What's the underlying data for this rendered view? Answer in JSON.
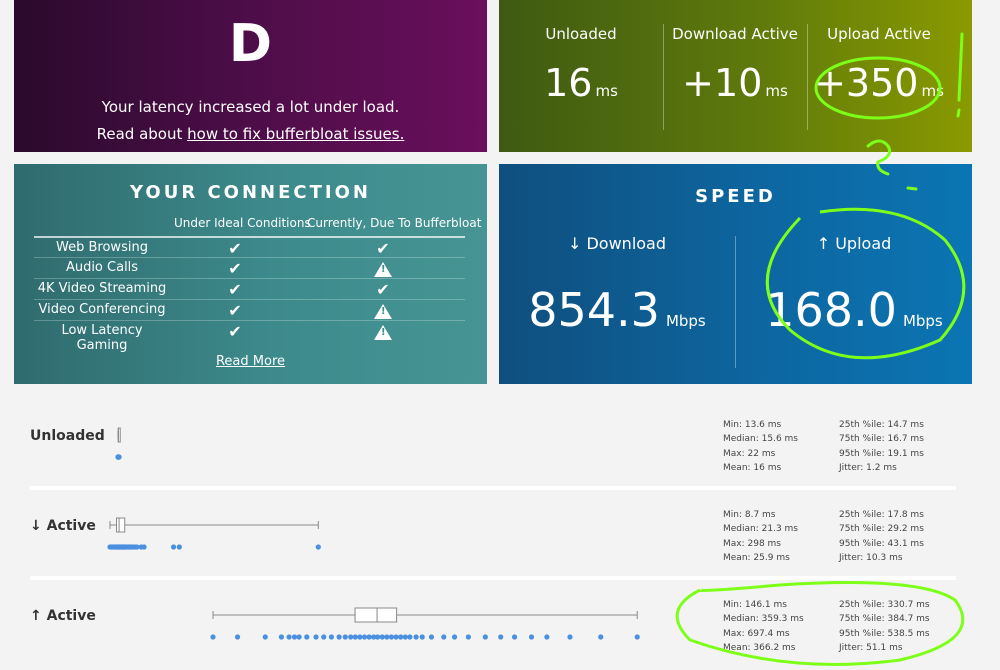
{
  "grade": {
    "letter": "D",
    "message": "Your latency increased a lot under load.",
    "read_about": "Read about ",
    "link_text": "how to fix bufferbloat issues."
  },
  "latency": [
    {
      "label": "Unloaded",
      "value": "16",
      "unit": "ms"
    },
    {
      "label": "Download Active",
      "value": "+10",
      "unit": "ms"
    },
    {
      "label": "Upload Active",
      "value": "+350",
      "unit": "ms"
    }
  ],
  "connection": {
    "title": "YOUR CONNECTION",
    "col_ideal": "Under Ideal Conditions",
    "col_now": "Currently, Due To Bufferbloat",
    "rows": [
      {
        "name": "Web Browsing",
        "ideal": "check",
        "now": "check"
      },
      {
        "name": "Audio Calls",
        "ideal": "check",
        "now": "warning"
      },
      {
        "name": "4K Video Streaming",
        "ideal": "check",
        "now": "check"
      },
      {
        "name": "Video Conferencing",
        "ideal": "check",
        "now": "warning"
      },
      {
        "name": "Low Latency Gaming",
        "ideal": "check",
        "now": "warning"
      }
    ],
    "read_more": "Read More"
  },
  "speed": {
    "title": "SPEED",
    "download": {
      "label": "↓ Download",
      "value": "854.3",
      "unit": "Mbps"
    },
    "upload": {
      "label": "↑ Upload",
      "value": "168.0",
      "unit": "Mbps"
    }
  },
  "stats": [
    {
      "title": "Unloaded",
      "left": [
        "Min: 13.6 ms",
        "Median: 15.6 ms",
        "Max: 22 ms",
        "Mean: 16 ms"
      ],
      "right": [
        "25th %ile: 14.7 ms",
        "75th %ile: 16.7 ms",
        "95th %ile: 19.1 ms",
        "Jitter: 1.2 ms"
      ],
      "box": {
        "min": 13.6,
        "q1": 14.7,
        "median": 15.6,
        "q3": 16.7,
        "max": 22
      },
      "points": [
        13.6,
        14.0,
        14.5,
        15.0,
        15.4,
        15.8,
        16.2,
        16.7,
        17.5,
        19.1
      ]
    },
    {
      "title": "↓ Active",
      "left": [
        "Min: 8.7 ms",
        "Median: 21.3 ms",
        "Max: 298 ms",
        "Mean: 25.9 ms"
      ],
      "right": [
        "25th %ile: 17.8 ms",
        "75th %ile: 29.2 ms",
        "95th %ile: 43.1 ms",
        "Jitter: 10.3 ms"
      ],
      "box": {
        "min": 8.7,
        "q1": 17.8,
        "median": 21.3,
        "q3": 29.2,
        "max": 298
      },
      "points": [
        8.7,
        11,
        13,
        15,
        17,
        18,
        19,
        20,
        21,
        22,
        23,
        24,
        25,
        26,
        27,
        28,
        29,
        30,
        32,
        34,
        36,
        38,
        40,
        43,
        46,
        52,
        56,
        97,
        105,
        298
      ]
    },
    {
      "title": "↑ Active",
      "left": [
        "Min: 146.1 ms",
        "Median: 359.3 ms",
        "Max: 697.4 ms",
        "Mean: 366.2 ms"
      ],
      "right": [
        "25th %ile: 330.7 ms",
        "75th %ile: 384.7 ms",
        "95th %ile: 538.5 ms",
        "Jitter: 51.1 ms"
      ],
      "box": {
        "min": 146.1,
        "q1": 330.7,
        "median": 359.3,
        "q3": 384.7,
        "max": 697.4
      },
      "points": [
        146.1,
        178,
        214,
        235,
        245,
        252,
        258,
        268,
        280,
        290,
        300,
        310,
        318,
        325,
        331,
        337,
        343,
        349,
        355,
        360,
        366,
        372,
        378,
        384,
        390,
        396,
        402,
        410,
        418,
        430,
        446,
        460,
        478,
        500,
        520,
        538,
        560,
        580,
        610,
        650,
        697.4
      ]
    }
  ],
  "colors": {
    "grade_bg": "#4a0d46",
    "latency_bg": "#5f7a0b",
    "connection_bg": "#3d8a8c",
    "speed_bg": "#0d66a0",
    "points": "#4a8fe0",
    "annotation": "#7dff1a"
  }
}
